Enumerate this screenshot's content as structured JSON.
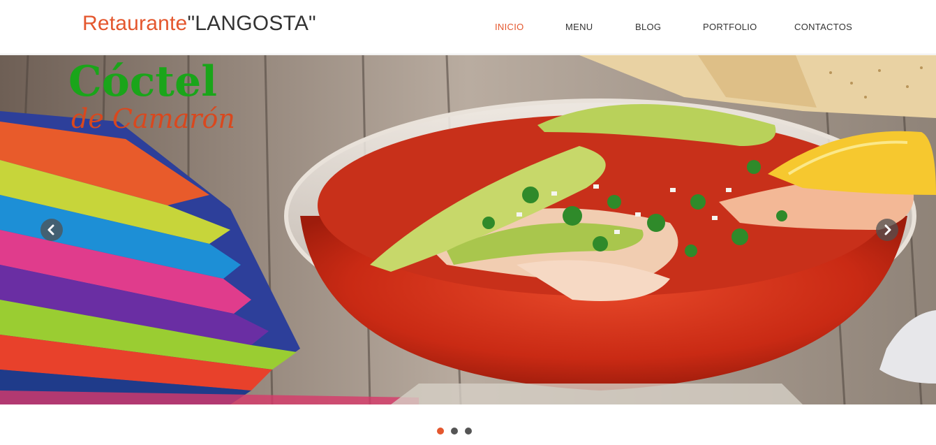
{
  "header": {
    "brand_accent": "Retaurante",
    "brand_rest": "\"LANGOSTA\"",
    "nav": [
      "INICIO",
      "MENU",
      "BLOG",
      "PORTFOLIO",
      "CONTACTOS"
    ],
    "active_nav": "INICIO"
  },
  "slider": {
    "slide_title_line1": "Cóctel",
    "slide_title_line2": "de Camarón",
    "prev_icon": "chevron-left-icon",
    "next_icon": "chevron-right-icon",
    "slide_count": 3,
    "active_slide": 1
  },
  "colors": {
    "accent": "#e4572e",
    "text": "#333333",
    "dot_inactive": "#555555",
    "slide_title_green": "#1aa51a",
    "slide_subtitle_orange": "#d9481e"
  }
}
